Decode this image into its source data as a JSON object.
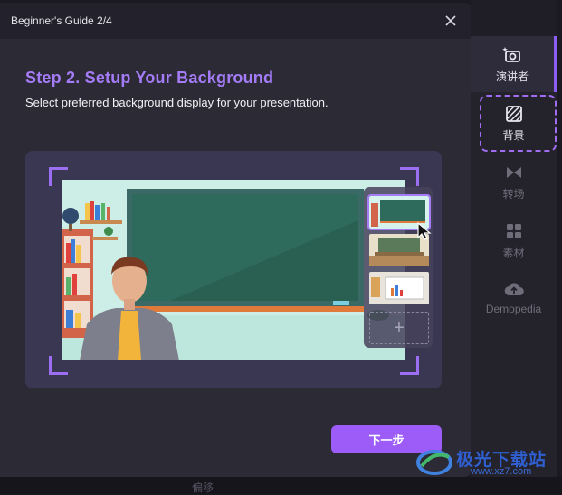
{
  "dialog": {
    "title": "Beginner's Guide 2/4",
    "step_title": "Step 2. Setup Your Background",
    "step_description": "Select preferred background display for your presentation.",
    "next_button": "下一步"
  },
  "sidebar": {
    "items": [
      {
        "label": "演讲者",
        "icon": "camera-sparkle-icon",
        "state": "active"
      },
      {
        "label": "背景",
        "icon": "background-icon",
        "state": "highlighted"
      },
      {
        "label": "转场",
        "icon": "transition-icon",
        "state": "normal"
      },
      {
        "label": "素材",
        "icon": "grid-icon",
        "state": "normal"
      },
      {
        "label": "Demopedia",
        "icon": "cloud-upload-icon",
        "state": "normal"
      }
    ]
  },
  "bottom_bar": {
    "label": "偏移"
  },
  "watermark": {
    "brand": "极光下载站",
    "url": "www.xz7.com"
  },
  "colors": {
    "accent": "#9d5cf7",
    "title_purple": "#a57cf7",
    "dialog_bg": "#2b2a35",
    "header_bg": "#23222c",
    "panel_bg": "#3a3753"
  }
}
